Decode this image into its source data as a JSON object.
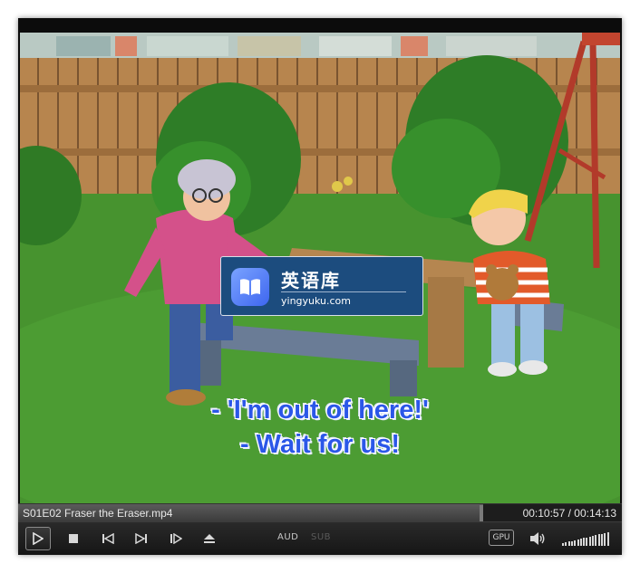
{
  "video": {
    "subtitle_lines": [
      "- 'I'm out of here!'",
      "- Wait for us!"
    ]
  },
  "watermark": {
    "name_cn": "英语库",
    "url": "yingyuku.com"
  },
  "infobar": {
    "filename": "S01E02 Fraser the Eraser.mp4",
    "time": "00:10:57 / 00:14:13",
    "progress_fraction": 0.77
  },
  "controls": {
    "audio_label": "AUD",
    "subtitle_label": "SUB",
    "gpu_label": "GPU",
    "volume_level": 1.0
  },
  "icons": [
    "play-icon",
    "stop-icon",
    "previous-icon",
    "next-icon",
    "frame-step-icon",
    "eject-icon",
    "speaker-icon"
  ],
  "colors": {
    "subtitle": "#2b57e8",
    "player_bg": "#0c0c0c",
    "watermark_bg": "#1c4c7e"
  }
}
